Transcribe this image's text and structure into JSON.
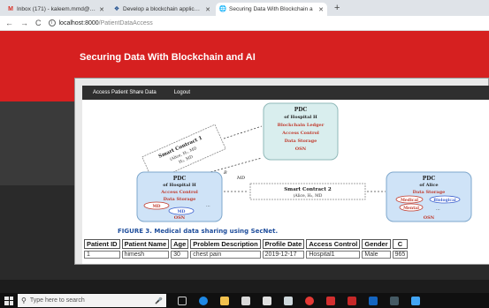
{
  "browser": {
    "tabs": [
      {
        "label": "Inbox (171) - kaleem.mmd@gma",
        "icon": "gmail-icon",
        "active": false
      },
      {
        "label": "Develop a blockchain application",
        "icon": "app-icon",
        "active": false
      },
      {
        "label": "Securing Data With Blockchain a",
        "icon": "globe-icon",
        "active": true
      }
    ],
    "new_tab_symbol": "+",
    "address": {
      "host": "localhost:8000",
      "path": "/PatientDataAccess"
    }
  },
  "page": {
    "title": "Securing Data With Blockchain and AI",
    "nav": {
      "access_label": "Access Patient Share Data",
      "logout_label": "Logout"
    },
    "figure": {
      "pdc_top": {
        "line1": "PDC",
        "line2": "of Hospital H",
        "line3": "Blockchain Ledger",
        "line4": "Access Control",
        "line5": "Data Storage",
        "line6": "OSN"
      },
      "smart_contract_1": {
        "line1": "Smart Contract 1",
        "line2": "(Alice, H₁, MD",
        "line3": "H₂, MD"
      },
      "pdc_left": {
        "line1": "PDC",
        "line2": "of Hospital H",
        "line3": "Access Control",
        "line4": "Data Storage",
        "md1": "MD",
        "md2": "MD",
        "osn": "OSN",
        "dots": "..."
      },
      "smart_contract_2": {
        "line1": "Smart Contract 2",
        "line2": "(Alice, H₂, MD"
      },
      "pdc_right": {
        "line1": "PDC",
        "line2": "of Alice",
        "line3": "Data Storage",
        "line4": "Medical",
        "line5": "Biological",
        "line6": "Mental",
        "osn": "OSN",
        "dots": "..."
      },
      "b_label": "B",
      "md_label": "MD",
      "caption": "FIGURE 3.   Medical data sharing using SecNet."
    },
    "table": {
      "headers": [
        "Patient ID",
        "Patient Name",
        "Age",
        "Problem Description",
        "Profile Date",
        "Access Control",
        "Gender",
        "C"
      ],
      "rows": [
        [
          "1",
          "himesh",
          "30",
          "chest pain",
          "2019-12-17",
          "Hospital1",
          "Male",
          "965"
        ]
      ]
    }
  },
  "taskbar": {
    "search_placeholder": "Type here to search"
  },
  "colors": {
    "banner": "#d62020",
    "nav": "#2f2f2f",
    "pdc_fill": "#d9eeee",
    "hospital_fill": "#cfe3f7"
  }
}
